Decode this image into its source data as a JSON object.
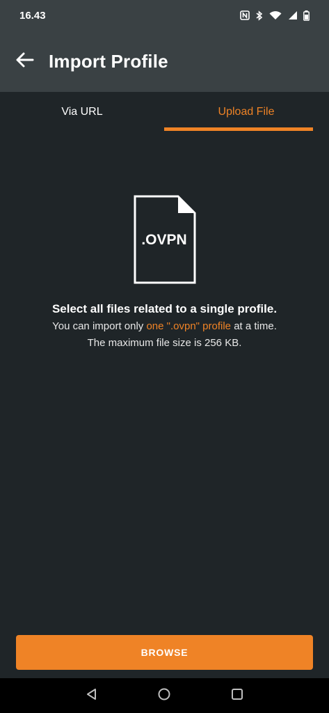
{
  "status_bar": {
    "time": "16.43",
    "icons": [
      "nfc-icon",
      "bluetooth-icon",
      "wifi-icon",
      "signal-icon",
      "battery-icon"
    ]
  },
  "app_bar": {
    "title": "Import Profile",
    "back_icon": "arrow-left-icon"
  },
  "tabs": [
    {
      "label": "Via URL",
      "active": false
    },
    {
      "label": "Upload File",
      "active": true
    }
  ],
  "content": {
    "file_icon_label": ".OVPN",
    "headline": "Select all files related to a single profile.",
    "line1_prefix": "You can import only ",
    "line1_highlight": "one \".ovpn\" profile",
    "line1_suffix": " at a time.",
    "line2": "The maximum file size is 256 KB."
  },
  "browse_button": {
    "label": "BROWSE"
  },
  "colors": {
    "accent": "#ef8326",
    "background": "#1f2528",
    "app_bar": "#3a4144"
  }
}
